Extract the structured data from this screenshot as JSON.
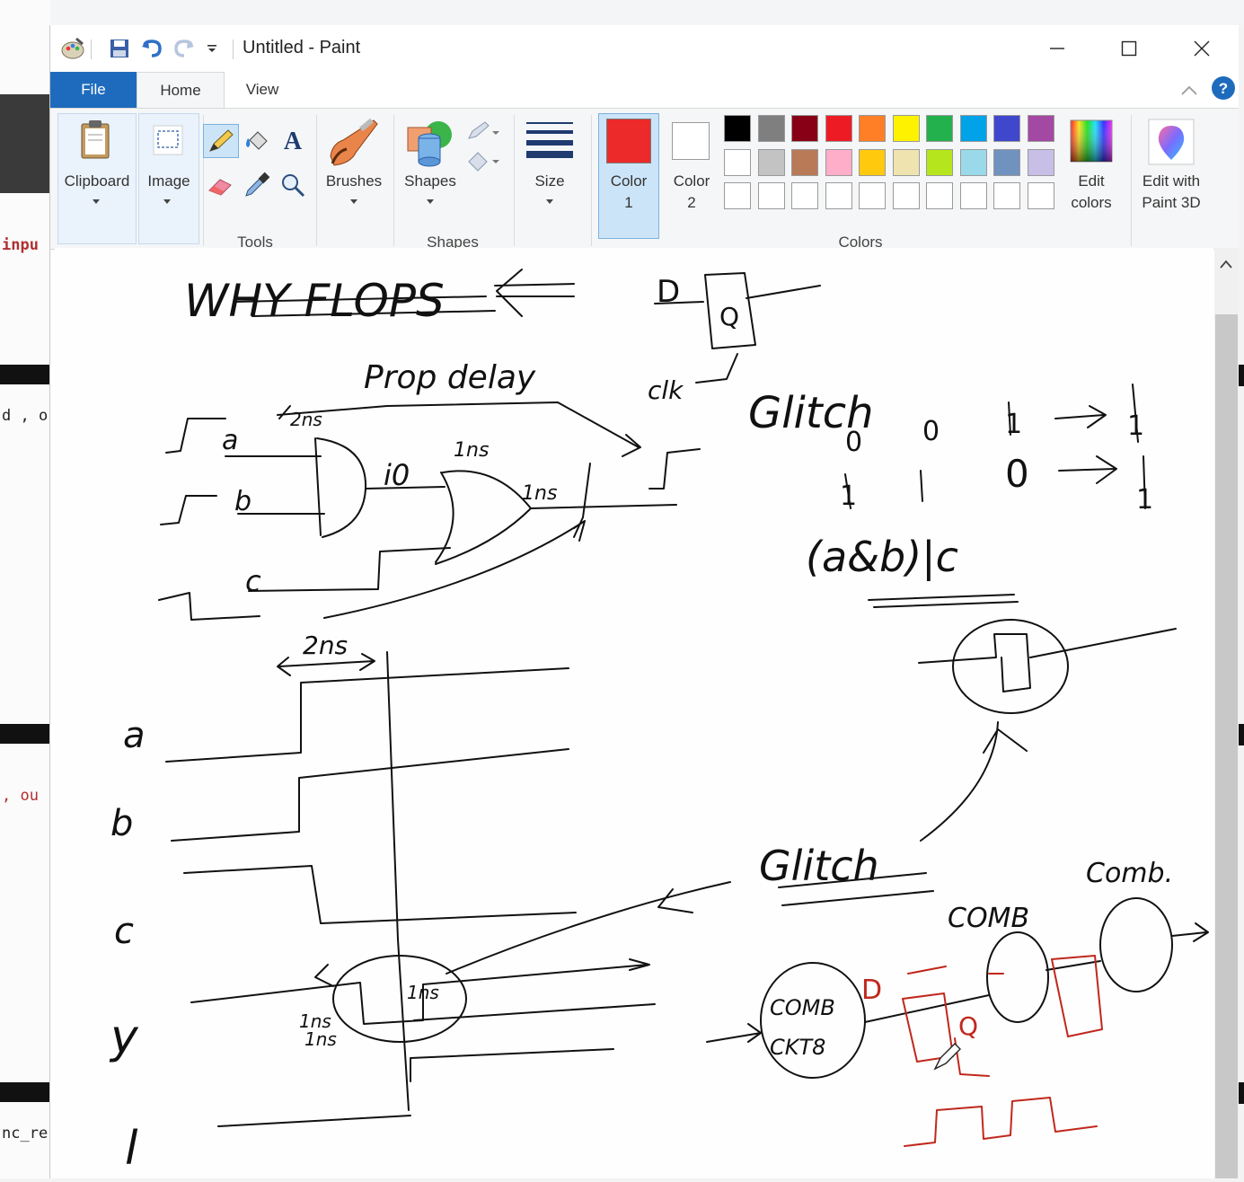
{
  "window": {
    "title": "Untitled - Paint"
  },
  "tabs": {
    "file": "File",
    "home": "Home",
    "view": "View"
  },
  "ribbon": {
    "clipboard": "Clipboard",
    "image": "Image",
    "tools_group": "Tools",
    "brushes": "Brushes",
    "shapes": "Shapes",
    "shapes_group": "Shapes",
    "size": "Size",
    "color1_line1": "Color",
    "color1_line2": "1",
    "color2_line1": "Color",
    "color2_line2": "2",
    "colors_group": "Colors",
    "edit_colors_line1": "Edit",
    "edit_colors_line2": "colors",
    "paint3d_line1": "Edit with",
    "paint3d_line2": "Paint 3D"
  },
  "colors": {
    "accent": "#1e6bbd",
    "color1": "#ec2a2a",
    "color2": "#ffffff",
    "palette_row1": [
      "#000000",
      "#7f7f7f",
      "#880015",
      "#ed1c24",
      "#ff7f27",
      "#fff200",
      "#22b14c",
      "#00a2e8",
      "#3f48cc",
      "#a349a4"
    ],
    "palette_row2": [
      "#ffffff",
      "#c3c3c3",
      "#b97a57",
      "#ffaec9",
      "#ffc90e",
      "#efe4b0",
      "#b5e61d",
      "#99d9ea",
      "#7092be",
      "#c8bfe7"
    ],
    "ink": "#111111",
    "ink_red": "#c0281c"
  },
  "background_fragments": {
    "frag1": "inpu",
    "frag2": "d , o",
    "frag3": ", ou",
    "frag4": "nc_re"
  },
  "sketch": {
    "t1": "WHY FLOPS",
    "t2": "Prop delay",
    "t3": "D",
    "t4": "Q",
    "t5": "clk",
    "t6": "Glitch",
    "t7": "a",
    "t8": "b",
    "t9": "c",
    "t10": "2ns",
    "t11": "1ns",
    "t12": "1ns",
    "t13": "1ns",
    "t14": "(a&b)|c",
    "t15": "a",
    "t16": "b",
    "t17": "c",
    "t18": "y",
    "t19": "l",
    "t20": "2ns",
    "t21": "Glitch",
    "t22": "COMB",
    "t23": "Comb.",
    "t24": "COMB",
    "t25": "CKT8",
    "t26": "D",
    "t27": "Q",
    "t28": "1ns",
    "t29": "1ns",
    "t30": "i0",
    "t31": "0",
    "t32": "0",
    "t33": "1",
    "t34": "1",
    "t35": "1",
    "t36": "1",
    "t37": "0"
  }
}
